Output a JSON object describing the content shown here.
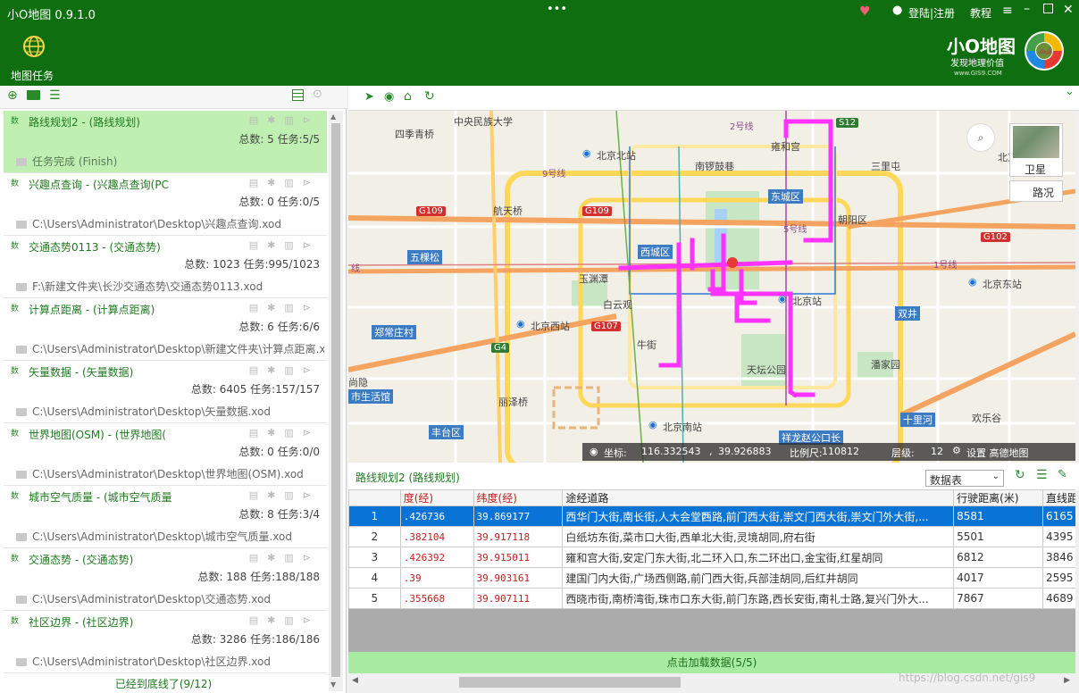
{
  "app": {
    "title": "小O地图 0.9.1.0",
    "login": "登陆|注册",
    "tutorial": "教程"
  },
  "header": {
    "nav_task_label": "地图任务",
    "brand_title": "小O地图",
    "brand_sub": "发现地理价值",
    "brand_url": "www.GIS9.COM"
  },
  "tasks": [
    {
      "name": "路线规划2 - (路线规划)",
      "count": "总数: 5 任务:5/5",
      "path": "任务完成 (Finish)",
      "kw": "数"
    },
    {
      "name": "兴趣点查询 - (兴趣点查询(PC",
      "count": "总数: 0 任务:0/5",
      "path": "C:\\Users\\Administrator\\Desktop\\兴趣点查询.xod",
      "kw": "数"
    },
    {
      "name": "交通态势0113 - (交通态势)",
      "count": "总数: 1023 任务:995/1023",
      "path": "F:\\新建文件夹\\长沙交通态势\\交通态势0113.xod",
      "kw": "数"
    },
    {
      "name": "计算点距离 - (计算点距离)",
      "count": "总数: 6 任务:6/6",
      "path": "C:\\Users\\Administrator\\Desktop\\新建文件夹\\计算点距离.x",
      "kw": "数"
    },
    {
      "name": "矢量数据 - (矢量数据)",
      "count": "总数: 6405 任务:157/157",
      "path": "C:\\Users\\Administrator\\Desktop\\矢量数据.xod",
      "kw": "数"
    },
    {
      "name": "世界地图(OSM) - (世界地图(",
      "count": "总数: 0 任务:0/0",
      "path": "C:\\Users\\Administrator\\Desktop\\世界地图(OSM).xod",
      "kw": "数"
    },
    {
      "name": "城市空气质量 - (城市空气质量",
      "count": "总数: 8 任务:3/4",
      "path": "C:\\Users\\Administrator\\Desktop\\城市空气质量.xod",
      "kw": "数"
    },
    {
      "name": "交通态势 - (交通态势)",
      "count": "总数: 188 任务:188/188",
      "path": "C:\\Users\\Administrator\\Desktop\\交通态势.xod",
      "kw": "数"
    },
    {
      "name": "社区边界 - (社区边界)",
      "count": "总数: 3286 任务:186/186",
      "path": "C:\\Users\\Administrator\\Desktop\\社区边界.xod",
      "kw": "数"
    }
  ],
  "list_footer": "已经到底线了(9/12)",
  "map": {
    "layer_satellite": "卫星",
    "layer_traffic": "路况",
    "labels": [
      "中央民族大学",
      "四季青桥",
      "北京北站",
      "南锣鼓巷",
      "雍和宫",
      "三里屯",
      "东城区",
      "航天桥",
      "朝阳区",
      "西城区",
      "玉渊潭",
      "五棵松",
      "白云观",
      "北京站",
      "北京东站",
      "北京西站",
      "双井",
      "牛街",
      "郑常庄村",
      "天坛公园",
      "潘家园",
      "尚隐",
      "市生活馆",
      "丽泽桥",
      "北京南站",
      "丰台区",
      "十里河",
      "欢乐谷",
      "祥龙赵公口长",
      "北京"
    ],
    "roads": [
      "G109",
      "G109",
      "G107",
      "G4",
      "G102",
      "S12",
      "2号线",
      "1号线",
      "9号线",
      "5号线",
      "线"
    ],
    "status": {
      "coord_label": "坐标:",
      "lng": "116.332543",
      "lat": "39.926883",
      "scale_label": "比例尺:",
      "scale": "110812",
      "level_label": "层级:",
      "level": "12",
      "settings": "设置 高德地图"
    }
  },
  "grid": {
    "title": "路线规划2 (路线规划)",
    "view_select": "数据表",
    "columns": [
      "度(经)",
      "纬度(经)",
      "途经道路",
      "行驶距离(米)",
      "直线距"
    ],
    "rows": [
      {
        "n": "1",
        "lng": ".426736",
        "lat": "39.869177",
        "roads": "西华门大街,南长街,人大会堂西路,前门西大街,崇文门西大街,崇文门外大街,...",
        "dist": "8581",
        "line": "6165"
      },
      {
        "n": "2",
        "lng": ".382104",
        "lat": "39.917118",
        "roads": "白纸坊东街,菜市口大街,西单北大街,灵境胡同,府右街",
        "dist": "5501",
        "line": "4395"
      },
      {
        "n": "3",
        "lng": ".426392",
        "lat": "39.915011",
        "roads": "雍和宫大街,安定门东大街,北二环入口,东二环出口,金宝街,红星胡同",
        "dist": "6812",
        "line": "3846"
      },
      {
        "n": "4",
        "lng": ".39",
        "lat": "39.903161",
        "roads": "建国门内大街,广场西侧路,前门西大街,兵部洼胡同,后红井胡同",
        "dist": "4017",
        "line": "2595"
      },
      {
        "n": "5",
        "lng": ".355668",
        "lat": "39.907111",
        "roads": "西晓市街,南桥湾街,珠市口东大街,前门东路,西长安街,南礼士路,复兴门外大...",
        "dist": "7867",
        "line": "4689"
      }
    ],
    "load_label": "点击加载数据(5/5)"
  },
  "watermark": "https://blog.csdn.net/gis9",
  "colors": {
    "brand_green": "#0f6e0f",
    "route": "#ff33ff",
    "selection": "#0a74d6"
  }
}
